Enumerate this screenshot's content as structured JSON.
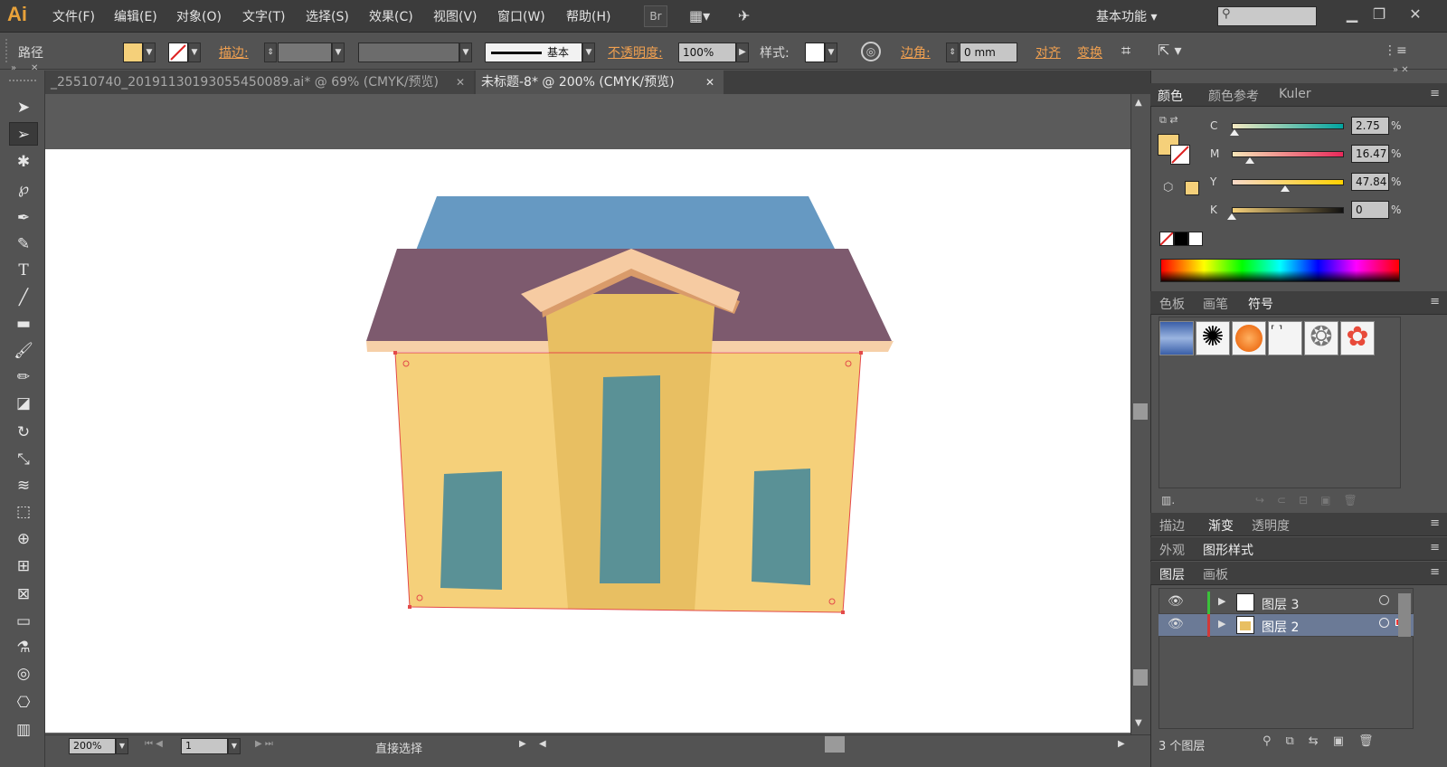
{
  "app": {
    "logo": "Ai",
    "workspace": "基本功能"
  },
  "menu": [
    "文件(F)",
    "编辑(E)",
    "对象(O)",
    "文字(T)",
    "选择(S)",
    "效果(C)",
    "视图(V)",
    "窗口(W)",
    "帮助(H)"
  ],
  "topbar": {
    "bridge": "Br"
  },
  "controlbar": {
    "selection_label": "路径",
    "stroke_label": "描边:",
    "stroke_style": "基本",
    "opacity_label": "不透明度:",
    "opacity_value": "100%",
    "style_label": "样式:",
    "corner_label": "边角:",
    "corner_value": "0 mm",
    "align_label": "对齐",
    "transform_label": "变换",
    "fill_color": "#f5d07a"
  },
  "tabs": [
    {
      "label": "_25510740_20191130193055450089.ai* @ 69% (CMYK/预览)",
      "active": false
    },
    {
      "label": "未标题-8* @ 200% (CMYK/预览)",
      "active": true
    }
  ],
  "status": {
    "zoom": "200%",
    "page": "1",
    "tool": "直接选择"
  },
  "color_panel": {
    "tabs": [
      "颜色",
      "颜色参考",
      "Kuler"
    ],
    "channels": [
      {
        "name": "C",
        "value": "2.75",
        "fraction": 0.0275
      },
      {
        "name": "M",
        "value": "16.47",
        "fraction": 0.1647
      },
      {
        "name": "Y",
        "value": "47.84",
        "fraction": 0.4784
      },
      {
        "name": "K",
        "value": "0",
        "fraction": 0
      }
    ],
    "unit": "%"
  },
  "swatch_panel": {
    "tabs": [
      "色板",
      "画笔",
      "符号"
    ]
  },
  "stroke_panel": {
    "tabs": [
      "描边",
      "渐变",
      "透明度"
    ]
  },
  "appearance_panel": {
    "tabs": [
      "外观",
      "图形样式"
    ]
  },
  "layers_panel": {
    "tabs": [
      "图层",
      "画板"
    ],
    "layers": [
      {
        "name": "图层 3"
      },
      {
        "name": "图层 2"
      }
    ],
    "footer": "3 个图层"
  },
  "colors": {
    "roof_blue": "#6699c2",
    "roof_purple": "#7d5a6e",
    "eave": "#f6d0a8",
    "wall": "#f5d07a",
    "center": "#e8bf62",
    "window": "#5a9196",
    "gable": "#f6cba2",
    "gable_dark": "#d99b6a",
    "selection": "#e34a4a"
  }
}
